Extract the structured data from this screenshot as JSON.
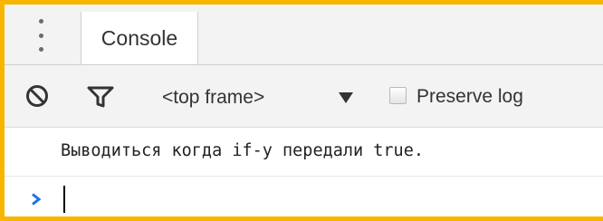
{
  "tabbar": {
    "tabs": [
      {
        "label": "Console"
      }
    ]
  },
  "toolbar": {
    "context_selector": "<top frame>",
    "preserve_log": {
      "label": "Preserve log",
      "checked": false
    }
  },
  "console": {
    "messages": [
      {
        "text": "Выводиться когда if-у передали true."
      }
    ],
    "input_value": ""
  },
  "colors": {
    "highlight_border": "#f7b500",
    "toolbar_bg": "#f3f3f3",
    "prompt_accent": "#1a73e8"
  },
  "icons": [
    "kebab-menu-icon",
    "clear-console-icon",
    "filter-icon",
    "dropdown-arrow-icon",
    "prompt-chevron-icon"
  ]
}
